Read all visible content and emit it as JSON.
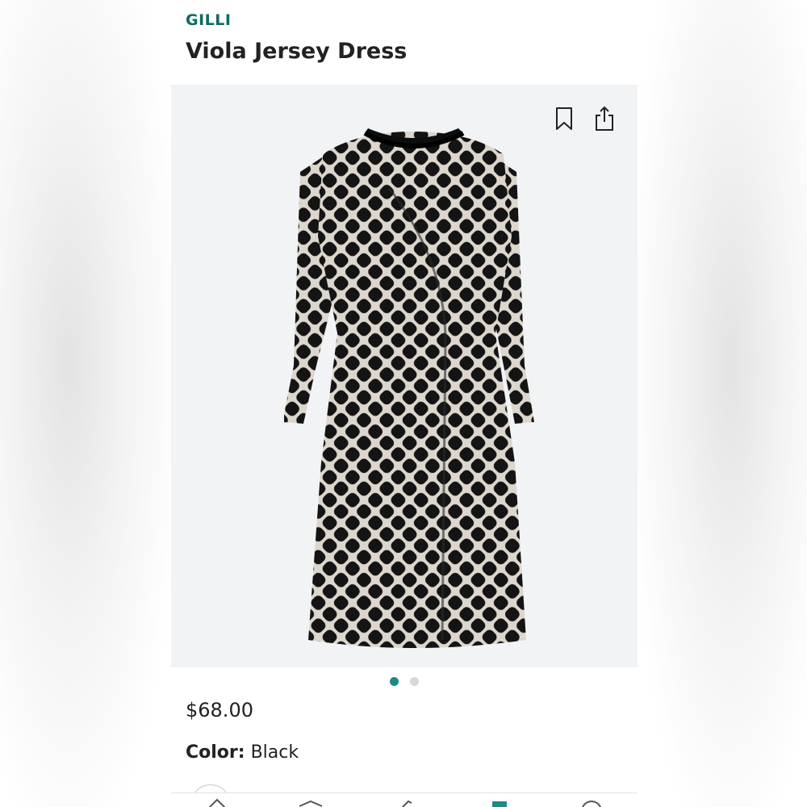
{
  "product": {
    "brand": "GILLI",
    "title": "Viola Jersey Dress",
    "price": "$68.00",
    "color_label": "Color:",
    "color_value": "Black"
  },
  "carousel": {
    "page_count": 2,
    "current_page": 1
  },
  "icons": {
    "bookmark": "bookmark-icon",
    "share": "share-icon"
  },
  "colors": {
    "brand": "#0f6b60",
    "accent": "#1b8b83",
    "image_bg": "#f2f3f5"
  },
  "bottom_nav": [
    {
      "icon": "home-icon"
    },
    {
      "icon": "shop-icon"
    },
    {
      "icon": "tag-icon"
    },
    {
      "icon": "fix-icon"
    },
    {
      "icon": "profile-icon"
    }
  ]
}
